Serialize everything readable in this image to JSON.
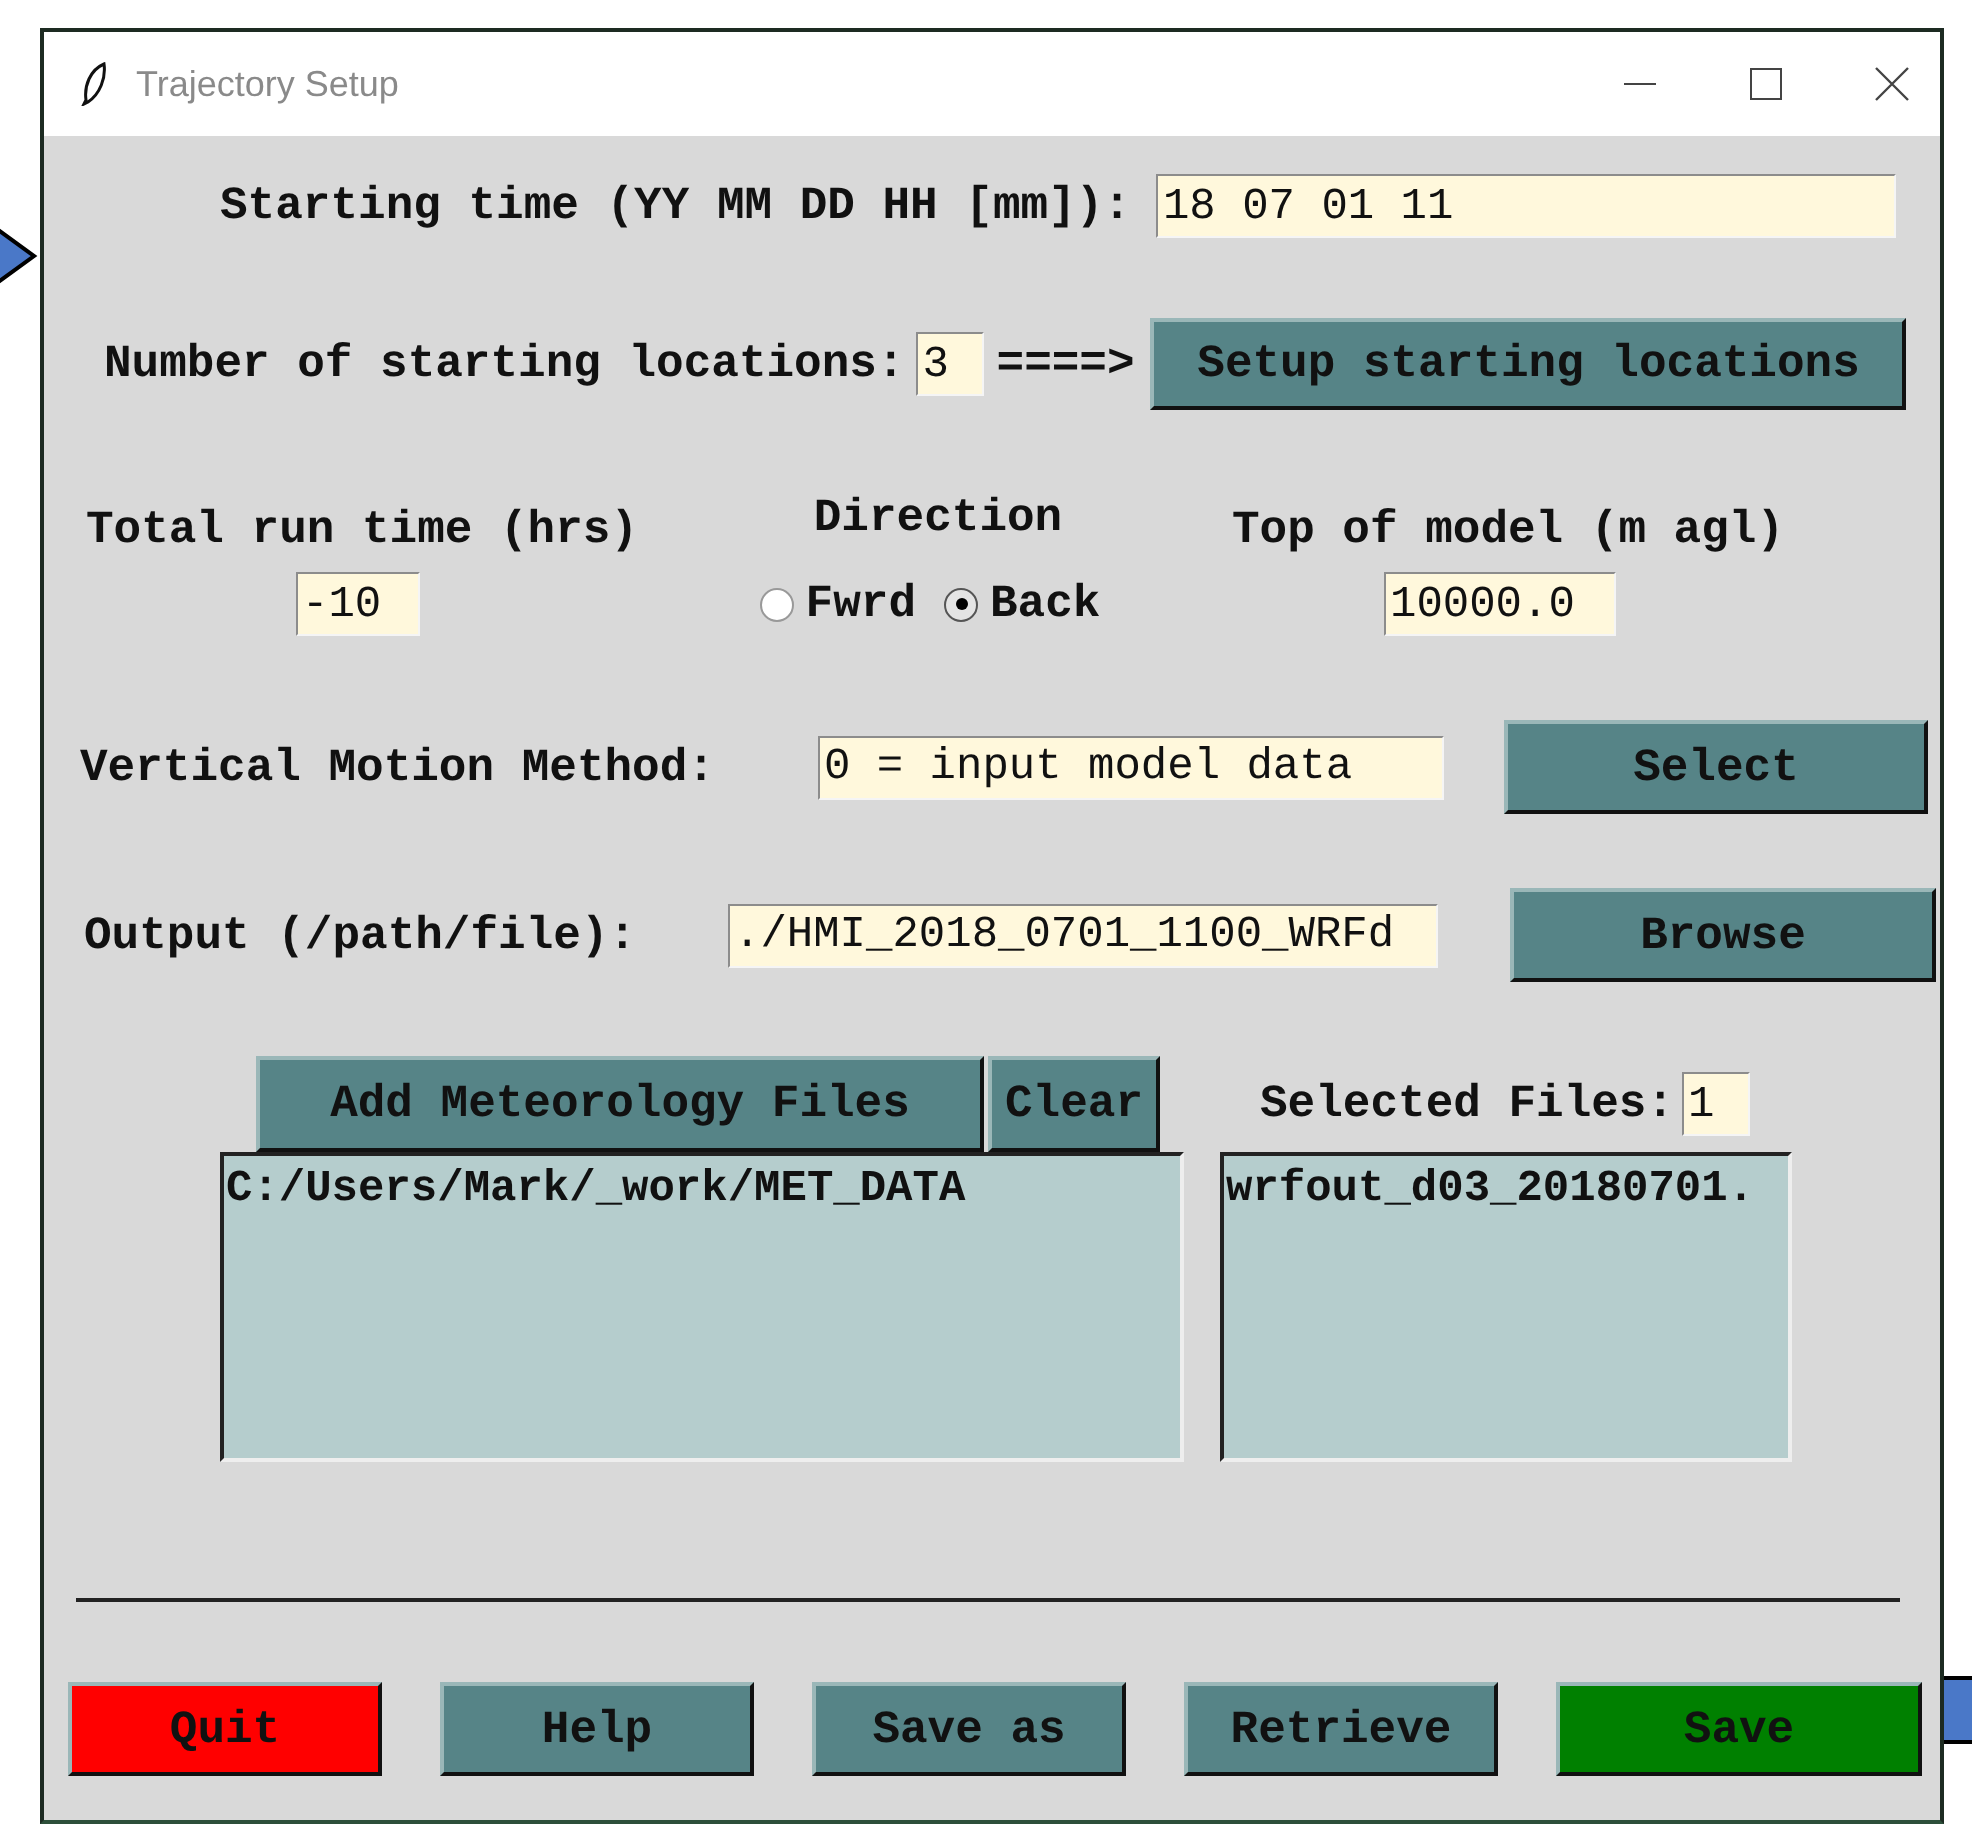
{
  "window": {
    "title": "Trajectory Setup"
  },
  "starting_time": {
    "label": "Starting time (YY MM DD HH [mm]):",
    "value": "18 07 01 11"
  },
  "starting_locations": {
    "label": "Number of starting locations:",
    "value": "3",
    "arrow": "====>",
    "button": "Setup starting locations"
  },
  "run_time": {
    "label": "Total run time (hrs)",
    "value": "-10"
  },
  "direction": {
    "label": "Direction",
    "options": [
      {
        "label": "Fwrd",
        "selected": false
      },
      {
        "label": "Back",
        "selected": true
      }
    ]
  },
  "top_of_model": {
    "label": "Top of model (m agl)",
    "value": "10000.0"
  },
  "vertical_motion": {
    "label": "Vertical Motion Method:",
    "value": "0 = input model data",
    "button": "Select"
  },
  "output": {
    "label": "Output (/path/file):",
    "value": "./HMI_2018_0701_1100_WRFd",
    "button": "Browse"
  },
  "meteorology": {
    "add_button": "Add Meteorology Files",
    "clear_button": "Clear",
    "directories": [
      "C:/Users/Mark/_work/MET_DATA"
    ],
    "selected_label": "Selected Files:",
    "selected_count": "1",
    "files": [
      "wrfout_d03_20180701."
    ]
  },
  "buttons": [
    {
      "label": "Quit",
      "kind": "quit"
    },
    {
      "label": "Help",
      "kind": "normal"
    },
    {
      "label": "Save as",
      "kind": "normal"
    },
    {
      "label": "Retrieve",
      "kind": "normal"
    },
    {
      "label": "Save",
      "kind": "save"
    }
  ]
}
